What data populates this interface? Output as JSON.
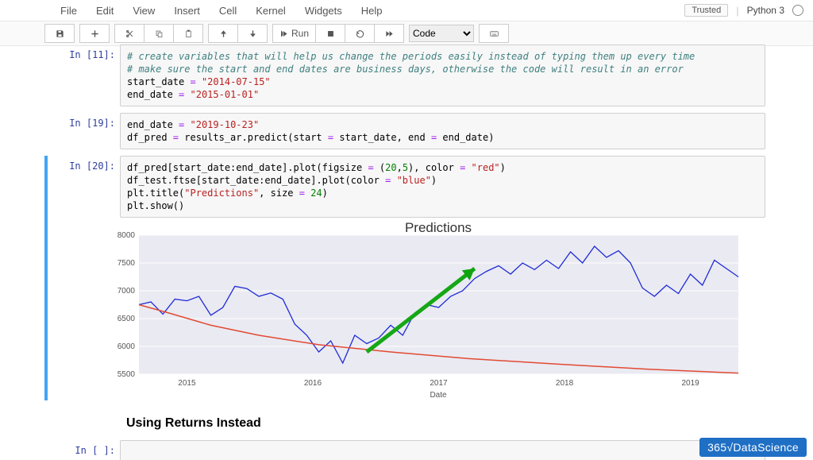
{
  "menubar": {
    "items": [
      "File",
      "Edit",
      "View",
      "Insert",
      "Cell",
      "Kernel",
      "Widgets",
      "Help"
    ],
    "trusted_label": "Trusted",
    "kernel_name": "Python 3"
  },
  "toolbar": {
    "run_label": "Run",
    "cell_type_value": "Code"
  },
  "cells": {
    "c0": {
      "prompt": "In [11]:",
      "comment1": "# create variables that will help us change the periods easily instead of typing them up every time",
      "comment2": "# make sure the start and end dates are business days, otherwise the code will result in an error",
      "line3a": "start_date ",
      "line3op": "=",
      "line3str": " \"2014-07-15\"",
      "line4a": "end_date ",
      "line4op": "=",
      "line4str": " \"2015-01-01\""
    },
    "c1": {
      "prompt": "In [19]:",
      "l1a": "end_date ",
      "l1op": "=",
      "l1str": " \"2019-10-23\"",
      "l2a": "df_pred ",
      "l2op": "=",
      "l2b": " results_ar.predict(start ",
      "l2op2": "=",
      "l2c": " start_date, end ",
      "l2op3": "=",
      "l2d": " end_date)"
    },
    "c2": {
      "prompt": "In [20]:",
      "l1a": "df_pred[start_date:end_date].plot(figsize ",
      "l1op": "=",
      "l1b": " (",
      "l1n1": "20",
      "l1c": ",",
      "l1n2": "5",
      "l1d": "), color ",
      "l1op2": "=",
      "l1str": " \"red\"",
      "l1e": ")",
      "l2a": "df_test.ftse[start_date:end_date].plot(color ",
      "l2op": "=",
      "l2str": " \"blue\"",
      "l2b": ")",
      "l3a": "plt.title(",
      "l3str": "\"Predictions\"",
      "l3b": ", size ",
      "l3op": "=",
      "l3n": " 24",
      "l3c": ")",
      "l4": "plt.show()"
    },
    "heading": "Using Returns Instead",
    "empty_prompt": "In [ ]:"
  },
  "logo": "365√DataScience",
  "chart_data": {
    "type": "line",
    "title": "Predictions",
    "xlabel": "Date",
    "ylabel": "",
    "ylim": [
      5500,
      8000
    ],
    "xrange": [
      "2014-07-15",
      "2019-10-23"
    ],
    "xticks": [
      "2015",
      "2016",
      "2017",
      "2018",
      "2019"
    ],
    "yticks": [
      5500,
      6000,
      6500,
      7000,
      7500,
      8000
    ],
    "series": [
      {
        "name": "df_pred (red)",
        "color": "#E24A33",
        "x_fraction": [
          0.0,
          0.05,
          0.12,
          0.2,
          0.3,
          0.42,
          0.55,
          0.7,
          0.85,
          1.0
        ],
        "y": [
          6750,
          6600,
          6380,
          6200,
          6030,
          5900,
          5780,
          5680,
          5590,
          5520
        ]
      },
      {
        "name": "df_test.ftse (blue)",
        "color": "#1E2BD6",
        "x_fraction": [
          0.0,
          0.02,
          0.04,
          0.06,
          0.08,
          0.1,
          0.12,
          0.14,
          0.16,
          0.18,
          0.2,
          0.22,
          0.24,
          0.26,
          0.28,
          0.3,
          0.32,
          0.34,
          0.36,
          0.38,
          0.4,
          0.42,
          0.44,
          0.46,
          0.48,
          0.5,
          0.52,
          0.54,
          0.56,
          0.58,
          0.6,
          0.62,
          0.64,
          0.66,
          0.68,
          0.7,
          0.72,
          0.74,
          0.76,
          0.78,
          0.8,
          0.82,
          0.84,
          0.86,
          0.88,
          0.9,
          0.92,
          0.94,
          0.96,
          0.98,
          1.0
        ],
        "y": [
          6750,
          6800,
          6580,
          6850,
          6820,
          6900,
          6560,
          6700,
          7080,
          7040,
          6900,
          6960,
          6850,
          6400,
          6200,
          5900,
          6100,
          5700,
          6200,
          6050,
          6150,
          6380,
          6200,
          6600,
          6750,
          6700,
          6900,
          7000,
          7220,
          7350,
          7450,
          7300,
          7500,
          7380,
          7550,
          7400,
          7700,
          7500,
          7800,
          7600,
          7720,
          7500,
          7050,
          6900,
          7100,
          6950,
          7300,
          7100,
          7550,
          7400,
          7250
        ]
      }
    ],
    "annotation_arrow": {
      "from_xy": [
        0.38,
        5900
      ],
      "to_xy": [
        0.56,
        7400
      ]
    }
  }
}
